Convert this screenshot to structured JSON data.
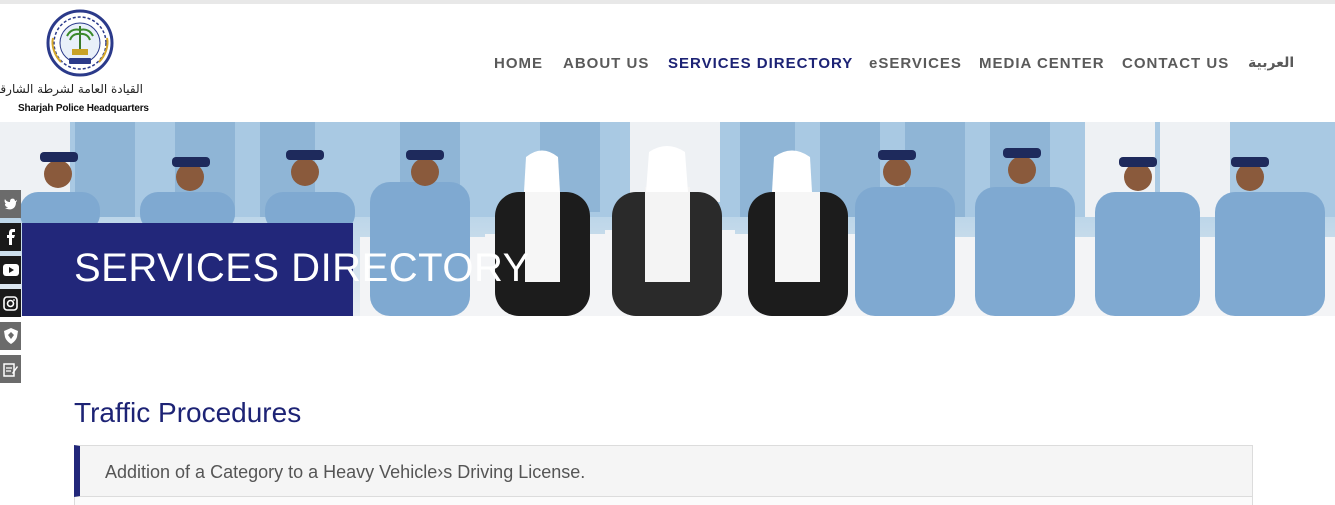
{
  "header": {
    "logo_arabic": "القيادة العامة لشرطة الشارقة",
    "logo_english": "Sharjah Police Headquarters",
    "nav": [
      {
        "label": "HOME",
        "active": false
      },
      {
        "label": "ABOUT US",
        "active": false
      },
      {
        "label": "SERVICES DIRECTORY",
        "active": true
      },
      {
        "label": "eSERVICES",
        "active": false
      },
      {
        "label": "MEDIA CENTER",
        "active": false
      },
      {
        "label": "CONTACT US",
        "active": false
      },
      {
        "label": "العربية",
        "active": false
      }
    ]
  },
  "banner": {
    "title": "SERVICES DIRECTORY"
  },
  "social": [
    "twitter-icon",
    "facebook-icon",
    "youtube-icon",
    "instagram-icon",
    "shield-icon",
    "edit-icon"
  ],
  "content": {
    "section_title": "Traffic Procedures",
    "items": [
      {
        "label": "Addition of a Category to a Heavy Vehicle›s Driving License."
      }
    ]
  },
  "colors": {
    "brand_navy": "#22277a",
    "nav_active": "#1d2375",
    "nav_text": "#5a5a5a"
  }
}
